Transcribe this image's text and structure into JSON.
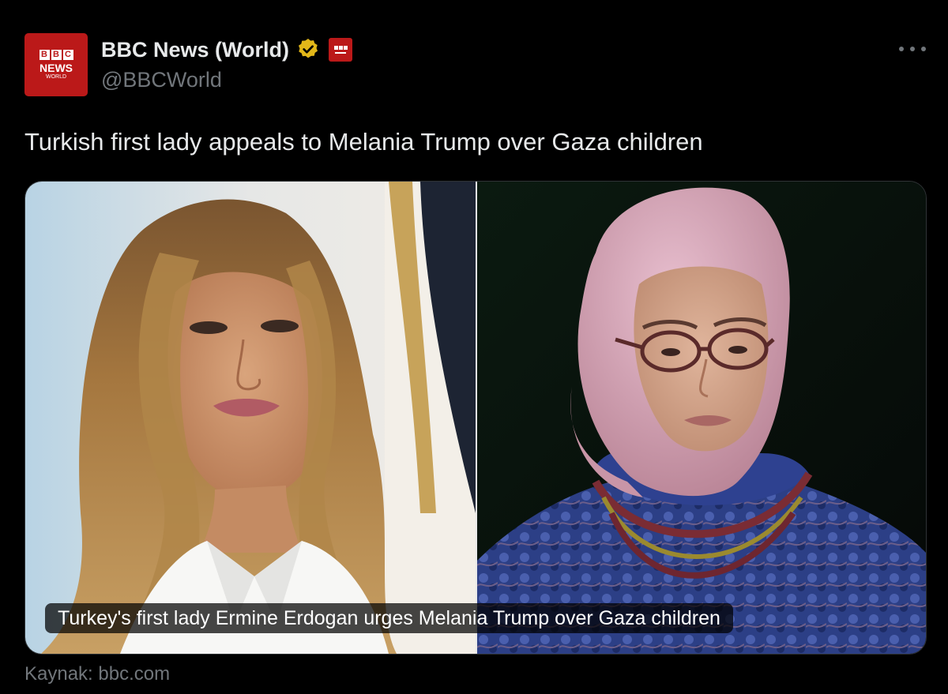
{
  "tweet": {
    "author": {
      "display_name": "BBC News (World)",
      "handle": "@BBCWorld",
      "avatar": {
        "blocks": [
          "B",
          "B",
          "C"
        ],
        "news": "NEWS",
        "world": "WORLD"
      },
      "verified_badge_icon": "gold-verified-icon",
      "affiliate_badge_icon": "bbc-news-affiliate-icon"
    },
    "more_icon": "more-horizontal-icon",
    "text": "Turkish first lady appeals to Melania Trump over Gaza children",
    "card": {
      "caption": "Turkey's first lady Ermine Erdogan urges Melania Trump over Gaza children",
      "left_image": "photo-woman-blonde-hair-white-shirt",
      "right_image": "photo-woman-pink-headscarf-glasses"
    },
    "source": "Kaynak: bbc.com"
  },
  "colors": {
    "background": "#000000",
    "primary_text": "#e7e9ea",
    "secondary_text": "#71767b",
    "bbc_red": "#bb1919",
    "verified_gold": "#e2b719"
  }
}
